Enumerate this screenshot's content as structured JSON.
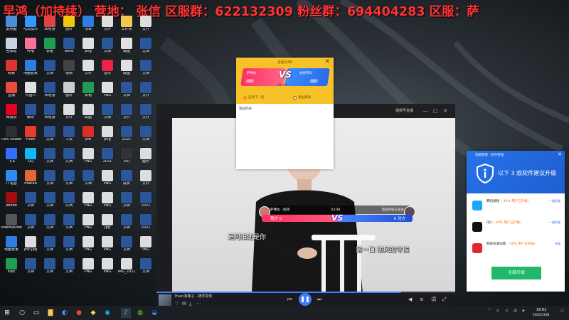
{
  "banner": {
    "text": "早鸿（加持续）  营地：  张信  区服群：622132309   粉丝群：694404283   区服：萨"
  },
  "desktop": {
    "icons": [
      {
        "label": "此电脑",
        "color": "#4c8fd6"
      },
      {
        "label": "吃瓜群众",
        "color": "#3399ff"
      },
      {
        "label": "米哈游",
        "color": "#dd4444"
      },
      {
        "label": "图片",
        "color": "#f1c40f"
      },
      {
        "label": "项目",
        "color": "#2f7de1"
      },
      {
        "label": "文件",
        "color": "#dedede"
      },
      {
        "label": "文件夹",
        "color": "#f3c950"
      },
      {
        "label": "文件",
        "color": "#dedede"
      },
      {
        "label": "回收站",
        "color": "#c7d3e0"
      },
      {
        "label": "哔哩",
        "color": "#fb7299"
      },
      {
        "label": "表格",
        "color": "#1f9d55"
      },
      {
        "label": "word",
        "color": "#2b579a"
      },
      {
        "label": "png",
        "color": "#e0e0e0"
      },
      {
        "label": "文档",
        "color": "#2b579a"
      },
      {
        "label": "截图",
        "color": "#e0e0e0"
      },
      {
        "label": "文档",
        "color": "#2b579a"
      },
      {
        "label": "网易",
        "color": "#d33"
      },
      {
        "label": "电脑管家",
        "color": "#2f7de1"
      },
      {
        "label": "文档",
        "color": "#2b579a"
      },
      {
        "label": "视频",
        "color": "#444"
      },
      {
        "label": "文件",
        "color": "#dedede"
      },
      {
        "label": "音乐",
        "color": "#e24"
      },
      {
        "label": "截图",
        "color": "#e0e0e0"
      },
      {
        "label": "文档",
        "color": "#2b579a"
      },
      {
        "label": "直播",
        "color": "#e74c3c"
      },
      {
        "label": "中国人",
        "color": "#e0e0e0"
      },
      {
        "label": "米哈游",
        "color": "#2b579a"
      },
      {
        "label": "图片",
        "color": "#ccc"
      },
      {
        "label": "表格",
        "color": "#1f9d55"
      },
      {
        "label": "PNG",
        "color": "#e0e0e0"
      },
      {
        "label": "文档",
        "color": "#2b579a"
      },
      {
        "label": "文件",
        "color": "#2b579a"
      },
      {
        "label": "网易云",
        "color": "#e60026"
      },
      {
        "label": "腾讯",
        "color": "#2b579a"
      },
      {
        "label": "米哈游",
        "color": "#2b579a"
      },
      {
        "label": "文件",
        "color": "#ddd"
      },
      {
        "label": "截图",
        "color": "#ddd"
      },
      {
        "label": "文档",
        "color": "#2b579a"
      },
      {
        "label": "文件",
        "color": "#2b579a"
      },
      {
        "label": "文件",
        "color": "#2b579a"
      },
      {
        "label": "OBS Studio",
        "color": "#302e31"
      },
      {
        "label": "Flash",
        "color": "#e63a2e"
      },
      {
        "label": "文档",
        "color": "#2b579a"
      },
      {
        "label": "工资",
        "color": "#2b579a"
      },
      {
        "label": "pdf",
        "color": "#d93025"
      },
      {
        "label": "png",
        "color": "#ddd"
      },
      {
        "label": "2021",
        "color": "#2b579a"
      },
      {
        "label": "文档",
        "color": "#2b579a"
      },
      {
        "label": "飞书",
        "color": "#3370ff"
      },
      {
        "label": "QQ",
        "color": "#12b7f5"
      },
      {
        "label": "文档",
        "color": "#2b579a"
      },
      {
        "label": "文档",
        "color": "#2b579a"
      },
      {
        "label": "PNG",
        "color": "#ddd"
      },
      {
        "label": "2021",
        "color": "#2b579a"
      },
      {
        "label": "VID",
        "color": "#333"
      },
      {
        "label": "图片",
        "color": "#ddd"
      },
      {
        "label": "TT语音",
        "color": "#2c8cf4"
      },
      {
        "label": "matlab",
        "color": "#e16737"
      },
      {
        "label": "文档",
        "color": "#2b579a"
      },
      {
        "label": "文档",
        "color": "#2b579a"
      },
      {
        "label": "文档",
        "color": "#2b579a"
      },
      {
        "label": "PNG",
        "color": "#ddd"
      },
      {
        "label": "戚安",
        "color": "#2b579a"
      },
      {
        "label": "文件",
        "color": "#ddd"
      },
      {
        "label": "Adobe",
        "color": "#a30d0d"
      },
      {
        "label": "文档",
        "color": "#2b579a"
      },
      {
        "label": "文档",
        "color": "#2b579a"
      },
      {
        "label": "文档",
        "color": "#2b579a"
      },
      {
        "label": "PNG",
        "color": "#ddd"
      },
      {
        "label": "PNG",
        "color": "#ddd"
      },
      {
        "label": "文档",
        "color": "#2b579a"
      },
      {
        "label": "2021",
        "color": "#2b579a"
      },
      {
        "label": "VideoStudio",
        "color": "#555"
      },
      {
        "label": "文档",
        "color": "#2b579a"
      },
      {
        "label": "文档",
        "color": "#2b579a"
      },
      {
        "label": "文档",
        "color": "#2b579a"
      },
      {
        "label": "PNG",
        "color": "#ddd"
      },
      {
        "label": "jpg",
        "color": "#ddd"
      },
      {
        "label": "文档",
        "color": "#2b579a"
      },
      {
        "label": "2021",
        "color": "#2b579a"
      },
      {
        "label": "电脑管家",
        "color": "#2f7de1"
      },
      {
        "label": "psc.jpg",
        "color": "#ddd"
      },
      {
        "label": "文档",
        "color": "#2b579a"
      },
      {
        "label": "文档",
        "color": "#2b579a"
      },
      {
        "label": "PNG",
        "color": "#ddd"
      },
      {
        "label": "PNG",
        "color": "#ddd"
      },
      {
        "label": "文档",
        "color": "#2b579a"
      },
      {
        "label": "IMG",
        "color": "#ddd"
      },
      {
        "label": "科研",
        "color": "#1f9d55"
      },
      {
        "label": "文档",
        "color": "#2b579a"
      },
      {
        "label": "文档",
        "color": "#2b579a"
      },
      {
        "label": "文档",
        "color": "#2b579a"
      },
      {
        "label": "PNG",
        "color": "#ddd"
      },
      {
        "label": "PNG",
        "color": "#ddd"
      },
      {
        "label": "IMG_2021",
        "color": "#ddd"
      },
      {
        "label": "文档",
        "color": "#2b579a"
      }
    ]
  },
  "player": {
    "brand": "视频号直播",
    "pk": {
      "left_name": "萨弗拉 - 加持",
      "right_name": "电竞阿科王先生",
      "timer": "03:48",
      "left_score": "我方 0",
      "right_score": "0 对方",
      "vs": "VS"
    },
    "subtitle_left": "是阿阳还是你",
    "subtitle_right": "是一口 随风的守候",
    "track": "Evan净尊子 - 随学青你",
    "progress": 0.82
  },
  "pk_window": {
    "title": "全民比PK",
    "left_name": "萨弗拉",
    "right_name": "电竞阿科",
    "vs": "VS",
    "timer": "03:48",
    "left_pill": "0分",
    "right_pill": "0分",
    "option_a": "自动下一轮",
    "option_b": "退出邀请",
    "list_label": "观战列表"
  },
  "updater": {
    "app_name": "电脑管家 · 软件管理",
    "headline": "以下 3 款软件建议升级",
    "items": [
      {
        "name": "腾讯视频",
        "pct": "（ 44% 用户已升级）",
        "desc": "",
        "link": "一键升级",
        "color": "#1fa6f5"
      },
      {
        "name": "QQ",
        "pct": "（ 40% 用户已升级）",
        "desc": "",
        "link": "一键升级",
        "color": "#111"
      },
      {
        "name": "网易有道词典",
        "pct": "（ 50% 用户已升级）",
        "desc": "",
        "link": "升级",
        "color": "#e0282e"
      }
    ],
    "cta": "全部升级"
  },
  "taskbar": {
    "start_icon": "windows-icon",
    "time": "16:02",
    "date": "2021/10/8"
  }
}
